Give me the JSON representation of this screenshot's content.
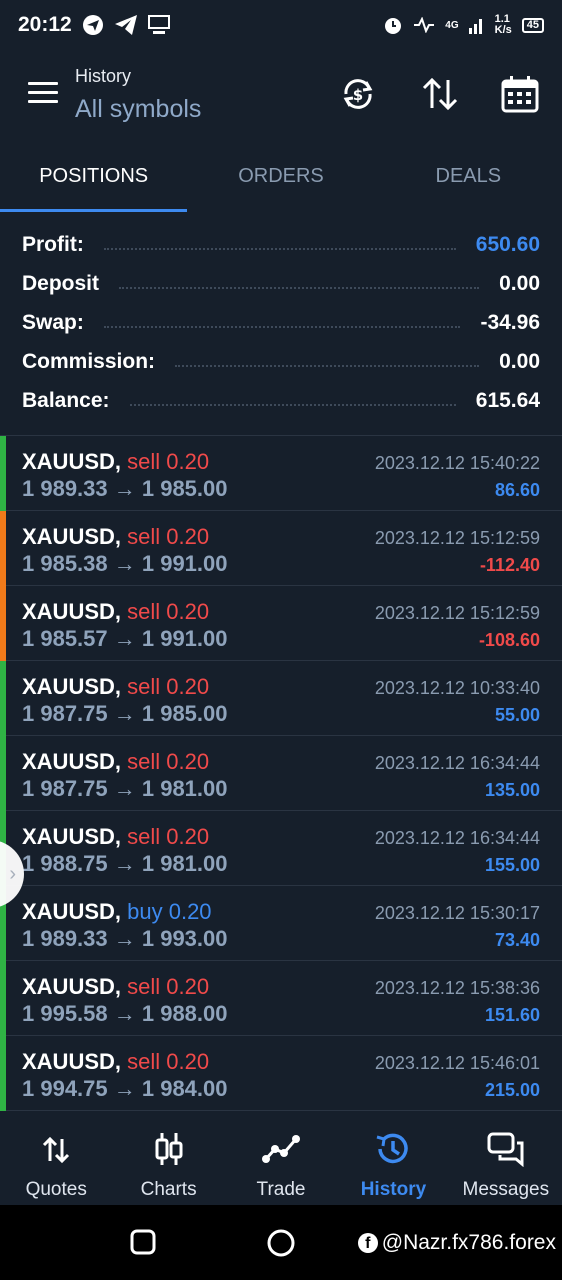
{
  "status": {
    "time": "20:12",
    "network": "4G",
    "speed_top": "1.1",
    "speed_bottom": "K/s",
    "battery": "45"
  },
  "header": {
    "title": "History",
    "subtitle": "All symbols"
  },
  "tabs": [
    {
      "label": "POSITIONS",
      "active": true
    },
    {
      "label": "ORDERS",
      "active": false
    },
    {
      "label": "DEALS",
      "active": false
    }
  ],
  "summary": {
    "profit_label": "Profit:",
    "profit_value": "650.60",
    "deposit_label": "Deposit",
    "deposit_value": "0.00",
    "swap_label": "Swap:",
    "swap_value": "-34.96",
    "commission_label": "Commission:",
    "commission_value": "0.00",
    "balance_label": "Balance:",
    "balance_value": "615.64"
  },
  "positions": [
    {
      "symbol": "XAUUSD,",
      "side": "sell 0.20",
      "prices": "1 989.33 → 1 985.00",
      "time": "2023.12.12 15:40:22",
      "profit": "86.60",
      "bar": "#2fb344"
    },
    {
      "symbol": "XAUUSD,",
      "side": "sell 0.20",
      "prices": "1 985.38 → 1 991.00",
      "time": "2023.12.12 15:12:59",
      "profit": "-112.40",
      "bar": "#f07a1a"
    },
    {
      "symbol": "XAUUSD,",
      "side": "sell 0.20",
      "prices": "1 985.57 → 1 991.00",
      "time": "2023.12.12 15:12:59",
      "profit": "-108.60",
      "bar": "#f07a1a"
    },
    {
      "symbol": "XAUUSD,",
      "side": "sell 0.20",
      "prices": "1 987.75 → 1 985.00",
      "time": "2023.12.12 10:33:40",
      "profit": "55.00",
      "bar": "#2fb344"
    },
    {
      "symbol": "XAUUSD,",
      "side": "sell 0.20",
      "prices": "1 987.75 → 1 981.00",
      "time": "2023.12.12 16:34:44",
      "profit": "135.00",
      "bar": "#2fb344"
    },
    {
      "symbol": "XAUUSD,",
      "side": "sell 0.20",
      "prices": "1 988.75 → 1 981.00",
      "time": "2023.12.12 16:34:44",
      "profit": "155.00",
      "bar": "#2fb344"
    },
    {
      "symbol": "XAUUSD,",
      "side": "buy 0.20",
      "prices": "1 989.33 → 1 993.00",
      "time": "2023.12.12 15:30:17",
      "profit": "73.40",
      "bar": "#2fb344"
    },
    {
      "symbol": "XAUUSD,",
      "side": "sell 0.20",
      "prices": "1 995.58 → 1 988.00",
      "time": "2023.12.12 15:38:36",
      "profit": "151.60",
      "bar": "#2fb344"
    },
    {
      "symbol": "XAUUSD,",
      "side": "sell 0.20",
      "prices": "1 994.75 → 1 984.00",
      "time": "2023.12.12 15:46:01",
      "profit": "215.00",
      "bar": "#2fb344"
    }
  ],
  "bottom_nav": [
    {
      "label": "Quotes",
      "icon": "quotes-icon",
      "active": false
    },
    {
      "label": "Charts",
      "icon": "charts-icon",
      "active": false
    },
    {
      "label": "Trade",
      "icon": "trade-icon",
      "active": false
    },
    {
      "label": "History",
      "icon": "history-icon",
      "active": true
    },
    {
      "label": "Messages",
      "icon": "messages-icon",
      "active": false
    }
  ],
  "watermark": "@Nazr.fx786.forex",
  "colors": {
    "accent": "#3d8af0",
    "sell": "#f04a4a",
    "profit_bar": "#2fb344",
    "loss_bar": "#f07a1a",
    "background": "#161f2b"
  }
}
